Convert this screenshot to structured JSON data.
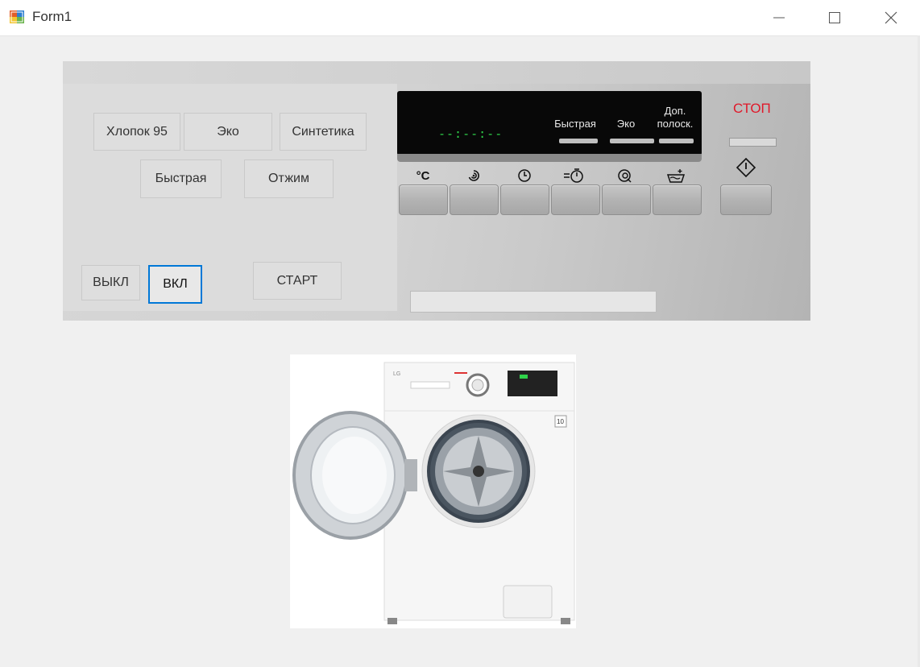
{
  "window": {
    "title": "Form1",
    "controls": [
      "minimize-icon",
      "maximize-icon",
      "close-icon"
    ]
  },
  "programs": {
    "cotton": "Хлопок 95",
    "eco": "Эко",
    "synthetic": "Синтетика",
    "quick": "Быстрая",
    "spin": "Отжим"
  },
  "power": {
    "off": "ВЫКЛ",
    "on": "ВКЛ",
    "start": "СТАРТ"
  },
  "display": {
    "time": "--:--:--",
    "quick_label": "Быстрая",
    "eco_label": "Эко",
    "rinse_label_1": "Доп.",
    "rinse_label_2": "полоск."
  },
  "panel_icons": {
    "temp": "°C",
    "spin": "spin-icon",
    "timer": "clock-icon",
    "delay": "delay-timer-icon",
    "eco": "eco-drum-icon",
    "rinse": "rinse-basin-icon"
  },
  "stop": {
    "label": "СТОП",
    "color": "#e0192a"
  },
  "colors": {
    "accent": "#0078d7",
    "segment": "#2ed24a"
  },
  "image": {
    "description": "washing-machine-photo"
  }
}
